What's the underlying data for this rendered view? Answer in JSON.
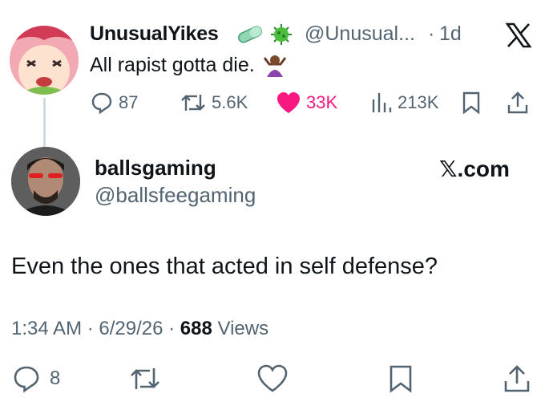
{
  "parent_tweet": {
    "display_name": "UnusualYikes",
    "handle": "@Unusual...",
    "separator": "·",
    "time_ago": "1d",
    "text": "All rapist gotta die.",
    "badges": [
      "pill-emoji",
      "virus-emoji"
    ],
    "text_emoji": "person-shrugging-emoji",
    "stats": {
      "replies": "87",
      "reposts": "5.6K",
      "likes": "33K",
      "views": "213K"
    }
  },
  "main_tweet": {
    "display_name": "ballsgaming",
    "handle": "@ballsfeegaming",
    "brand_watermark": "𝕏.com",
    "text": "Even the ones that acted in self defense?",
    "meta": {
      "time": "1:34 AM",
      "separator1": " · ",
      "date": "6/29/26",
      "separator2": " · ",
      "views_count": "688",
      "views_label": " Views"
    },
    "actions": {
      "replies": "8"
    }
  },
  "colors": {
    "text_primary": "#0f1419",
    "text_secondary": "#536471",
    "like_pink": "#f91880",
    "thread_line": "#cfd9de"
  }
}
